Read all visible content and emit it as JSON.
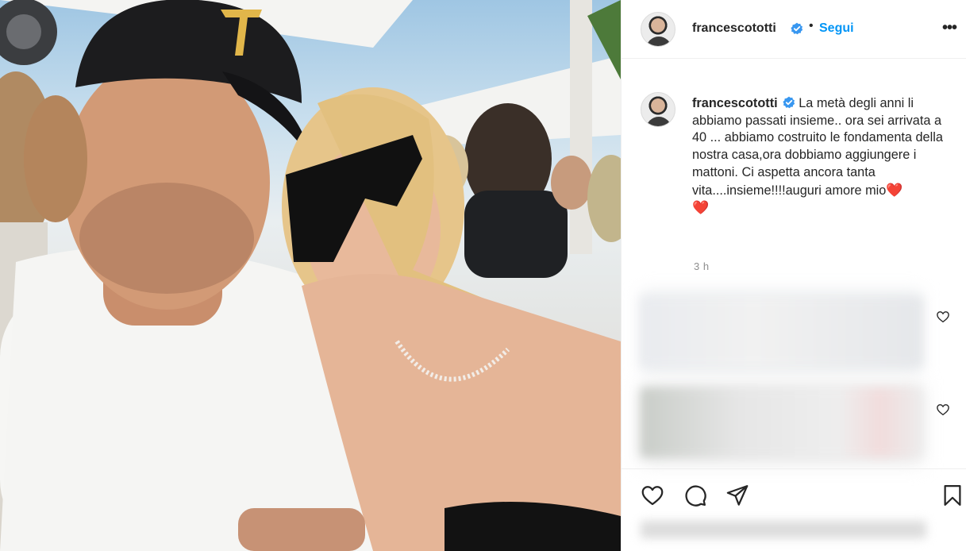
{
  "post": {
    "author": {
      "username": "francescototti",
      "verified": true,
      "follow_label": "Segui",
      "separator": "•"
    },
    "caption": {
      "username": "francescototti",
      "text": "La metà degli anni li abbiamo passati insieme.. ora sei arrivata a 40 ... abbiamo costruito le fondamenta della nostra casa,ora dobbiamo aggiungere i mattoni. Ci aspetta ancora tanta vita....insieme!!!!auguri amore mio",
      "emoji_end": "❤️",
      "emoji_line": "❤️"
    },
    "timestamp": "3 h",
    "more_menu_label": "•••",
    "accent_color": "#0095f6",
    "verified_color": "#3897f0",
    "heart_color": "#e0162b"
  },
  "actions": {
    "like_icon": "heart-outline-icon",
    "comment_icon": "speech-bubble-icon",
    "share_icon": "paper-plane-icon",
    "save_icon": "bookmark-icon"
  }
}
